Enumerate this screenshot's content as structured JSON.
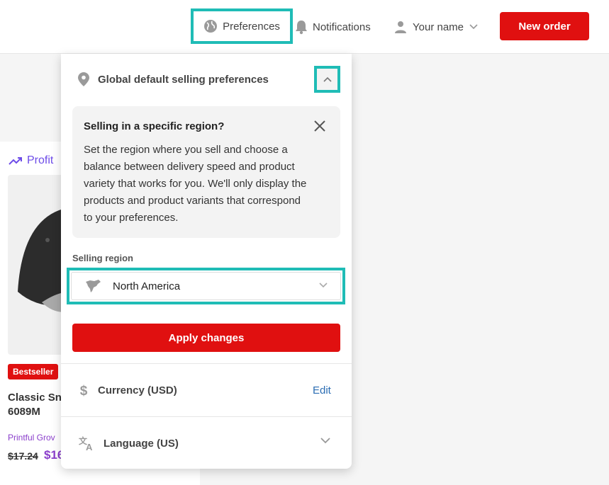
{
  "header": {
    "preferences_label": "Preferences",
    "notifications_label": "Notifications",
    "user_label": "Your name",
    "new_order_label": "New order",
    "icons": {
      "preferences": "globe-icon",
      "notifications": "bell-icon",
      "user": "user-icon",
      "user_menu": "chevron-down-icon"
    }
  },
  "background_card": {
    "profit_label": "Profit",
    "badge": "Bestseller",
    "product_name": "Classic Sn",
    "product_sku": "6089M",
    "growth_label": "Printful Grov",
    "price_old": "$17.24",
    "price_new": "$16"
  },
  "panel": {
    "section_title": "Global default selling preferences",
    "info_title": "Selling in a specific region?",
    "info_text": "Set the region where you sell and choose a balance between delivery speed and product variety that works for you. We'll only display the products and product variants that correspond to your preferences.",
    "region_label": "Selling region",
    "region_value": "North America",
    "apply_label": "Apply changes",
    "currency_label": "Currency (USD)",
    "currency_action": "Edit",
    "language_label": "Language (US)",
    "icons": {
      "section": "location-pin-icon",
      "collapse": "chevron-up-icon",
      "close": "close-icon",
      "region": "north-america-map-icon",
      "region_dropdown": "chevron-down-icon",
      "currency": "dollar-icon",
      "language": "translate-icon",
      "language_expand": "chevron-down-icon"
    }
  },
  "colors": {
    "accent_highlight": "#1fbcb6",
    "primary_button": "#e01010",
    "link": "#2b6db3",
    "profit": "#6d4ce8"
  }
}
